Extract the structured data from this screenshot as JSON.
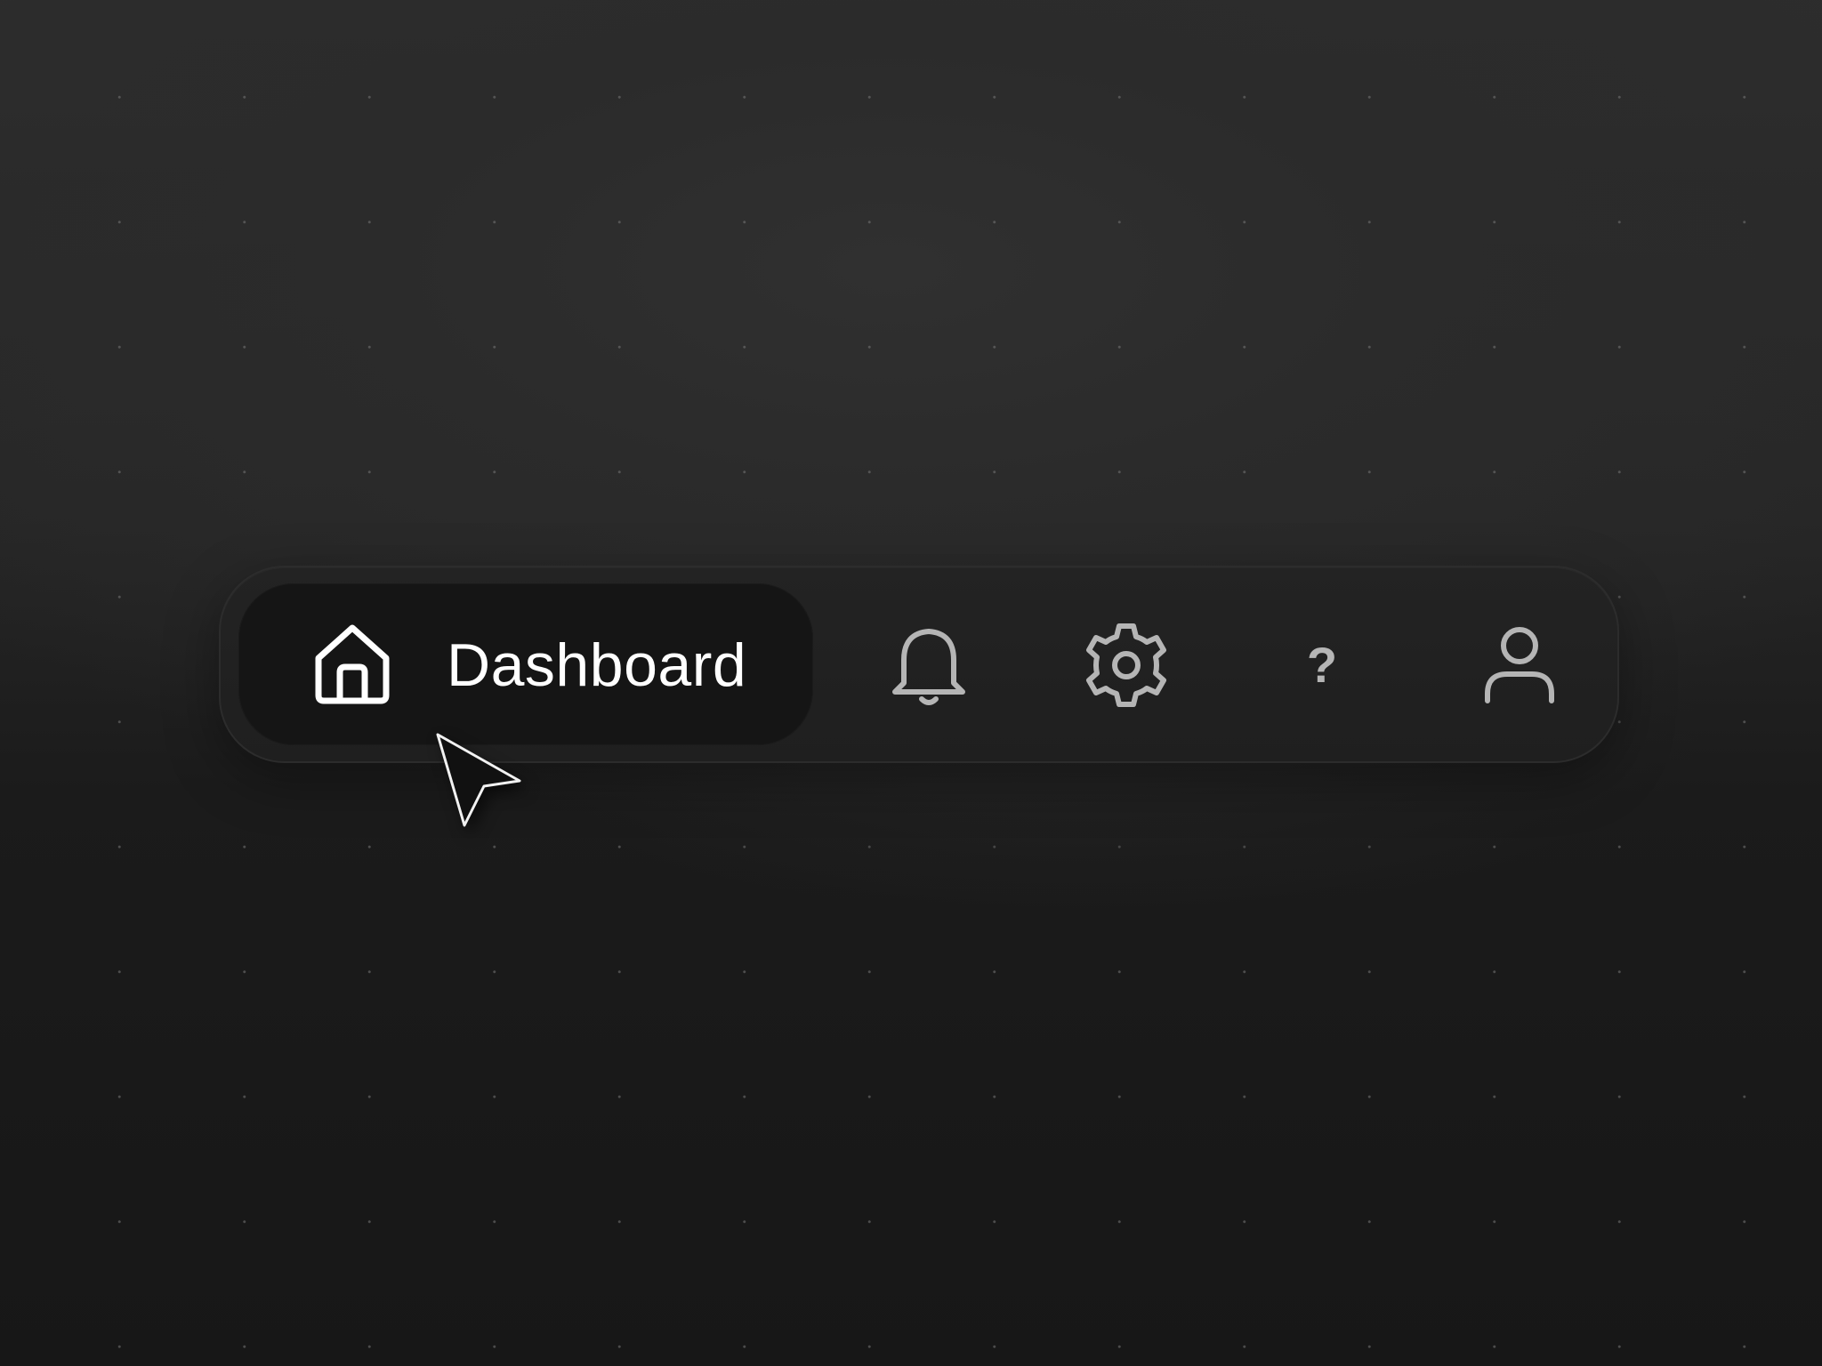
{
  "navbar": {
    "active_item": {
      "label": "Dashboard",
      "icon": "home-icon"
    },
    "items": [
      {
        "icon": "bell-icon",
        "name": "notifications"
      },
      {
        "icon": "gear-icon",
        "name": "settings"
      },
      {
        "icon": "help-icon",
        "name": "help",
        "glyph": "?"
      },
      {
        "icon": "user-icon",
        "name": "profile"
      }
    ]
  },
  "colors": {
    "background_top": "#2d2d2d",
    "background_bottom": "#171717",
    "navbar": "#212121",
    "active_pill": "#151515",
    "active_text": "#ffffff",
    "inactive_icon": "#b5b5b5"
  }
}
